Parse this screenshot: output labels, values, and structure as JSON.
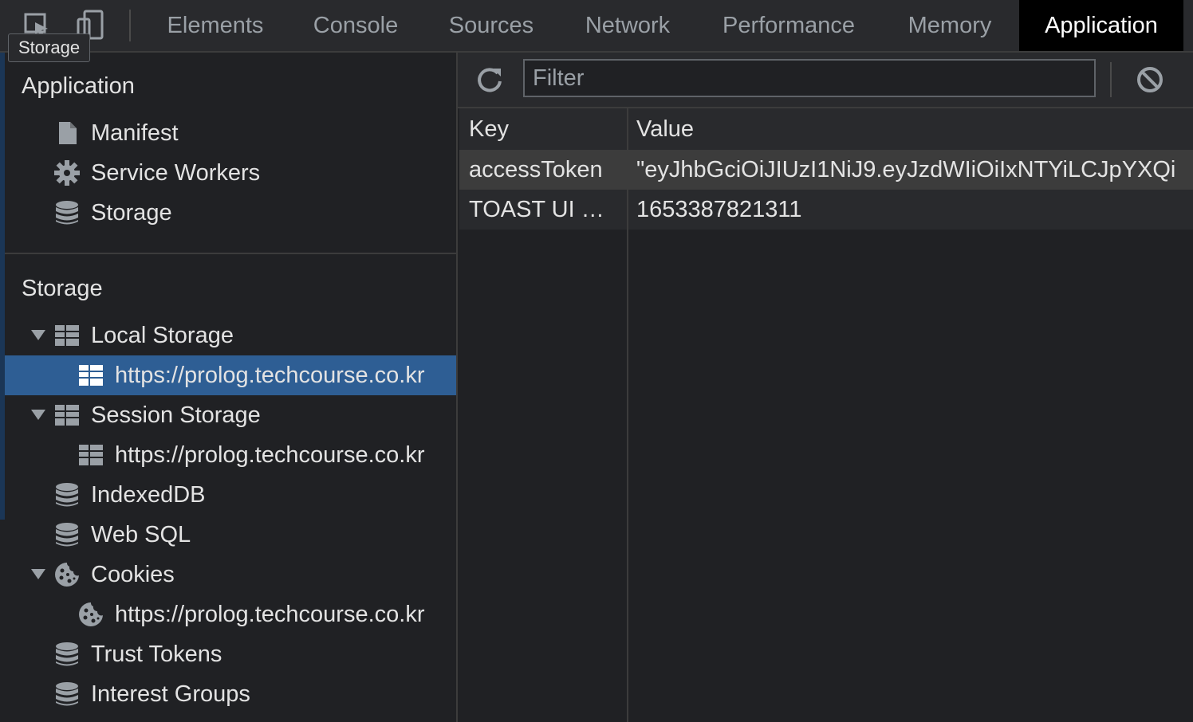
{
  "tabs": [
    {
      "label": "Elements"
    },
    {
      "label": "Console"
    },
    {
      "label": "Sources"
    },
    {
      "label": "Network"
    },
    {
      "label": "Performance"
    },
    {
      "label": "Memory"
    },
    {
      "label": "Application"
    }
  ],
  "active_tab": "Application",
  "tooltip": "Storage",
  "sidebar": {
    "application_title": "Application",
    "application_items": [
      {
        "label": "Manifest",
        "icon": "file-icon"
      },
      {
        "label": "Service Workers",
        "icon": "gear-icon"
      },
      {
        "label": "Storage",
        "icon": "database-icon"
      }
    ],
    "storage_title": "Storage",
    "storage_items": [
      {
        "label": "Local Storage",
        "icon": "table-icon",
        "expanded": true
      },
      {
        "label": "https://prolog.techcourse.co.kr",
        "icon": "table-icon",
        "selected": true
      },
      {
        "label": "Session Storage",
        "icon": "table-icon",
        "expanded": true
      },
      {
        "label": "https://prolog.techcourse.co.kr",
        "icon": "table-icon"
      },
      {
        "label": "IndexedDB",
        "icon": "database-icon"
      },
      {
        "label": "Web SQL",
        "icon": "database-icon"
      },
      {
        "label": "Cookies",
        "icon": "cookie-icon",
        "expanded": true
      },
      {
        "label": "https://prolog.techcourse.co.kr",
        "icon": "cookie-icon"
      },
      {
        "label": "Trust Tokens",
        "icon": "database-icon"
      },
      {
        "label": "Interest Groups",
        "icon": "database-icon"
      }
    ]
  },
  "main": {
    "filter_placeholder": "Filter",
    "columns": {
      "key": "Key",
      "value": "Value"
    },
    "rows": [
      {
        "key": "accessToken",
        "value": "\"eyJhbGciOiJIUzI1NiJ9.eyJzdWIiOiIxNTYiLCJpYXQi"
      },
      {
        "key": "TOAST UI …",
        "value": "1653387821311"
      }
    ]
  },
  "colors": {
    "background": "#202124",
    "selection": "#2e5e94",
    "active_tab": "#000000"
  }
}
